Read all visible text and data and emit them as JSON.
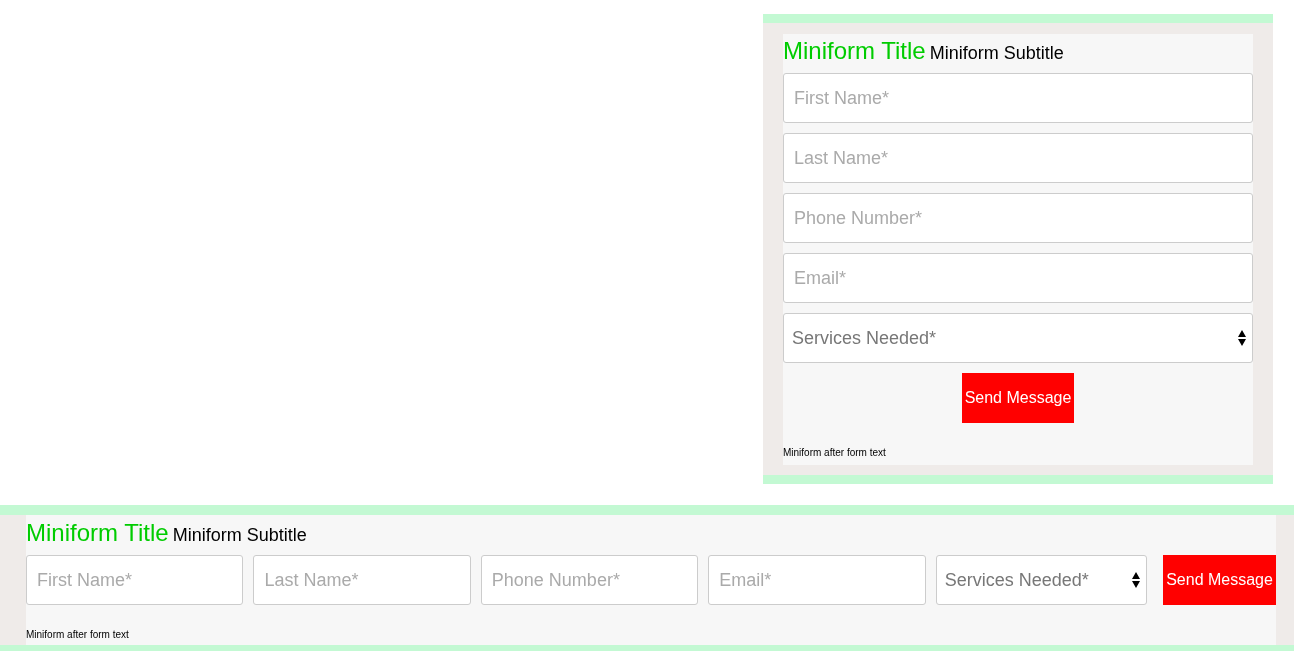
{
  "forms": [
    {
      "kind": "stacked",
      "title": "Miniform Title",
      "subtitle": "Miniform Subtitle",
      "fields": [
        {
          "kind": "text",
          "placeholder": "First Name*"
        },
        {
          "kind": "text",
          "placeholder": "Last Name*"
        },
        {
          "kind": "text",
          "placeholder": "Phone Number*"
        },
        {
          "kind": "text",
          "placeholder": "Email*"
        },
        {
          "kind": "select",
          "value": "Services Needed*"
        }
      ],
      "button": "Send Message",
      "after_text": "Miniform after form text"
    },
    {
      "kind": "inline",
      "title": "Miniform Title",
      "subtitle": "Miniform Subtitle",
      "fields": [
        {
          "kind": "text",
          "placeholder": "First Name*"
        },
        {
          "kind": "text",
          "placeholder": "Last Name*"
        },
        {
          "kind": "text",
          "placeholder": "Phone Number*"
        },
        {
          "kind": "text",
          "placeholder": "Email*"
        },
        {
          "kind": "select",
          "value": "Services Needed*"
        }
      ],
      "button": "Send Message",
      "after_text": "Miniform after form text"
    }
  ]
}
